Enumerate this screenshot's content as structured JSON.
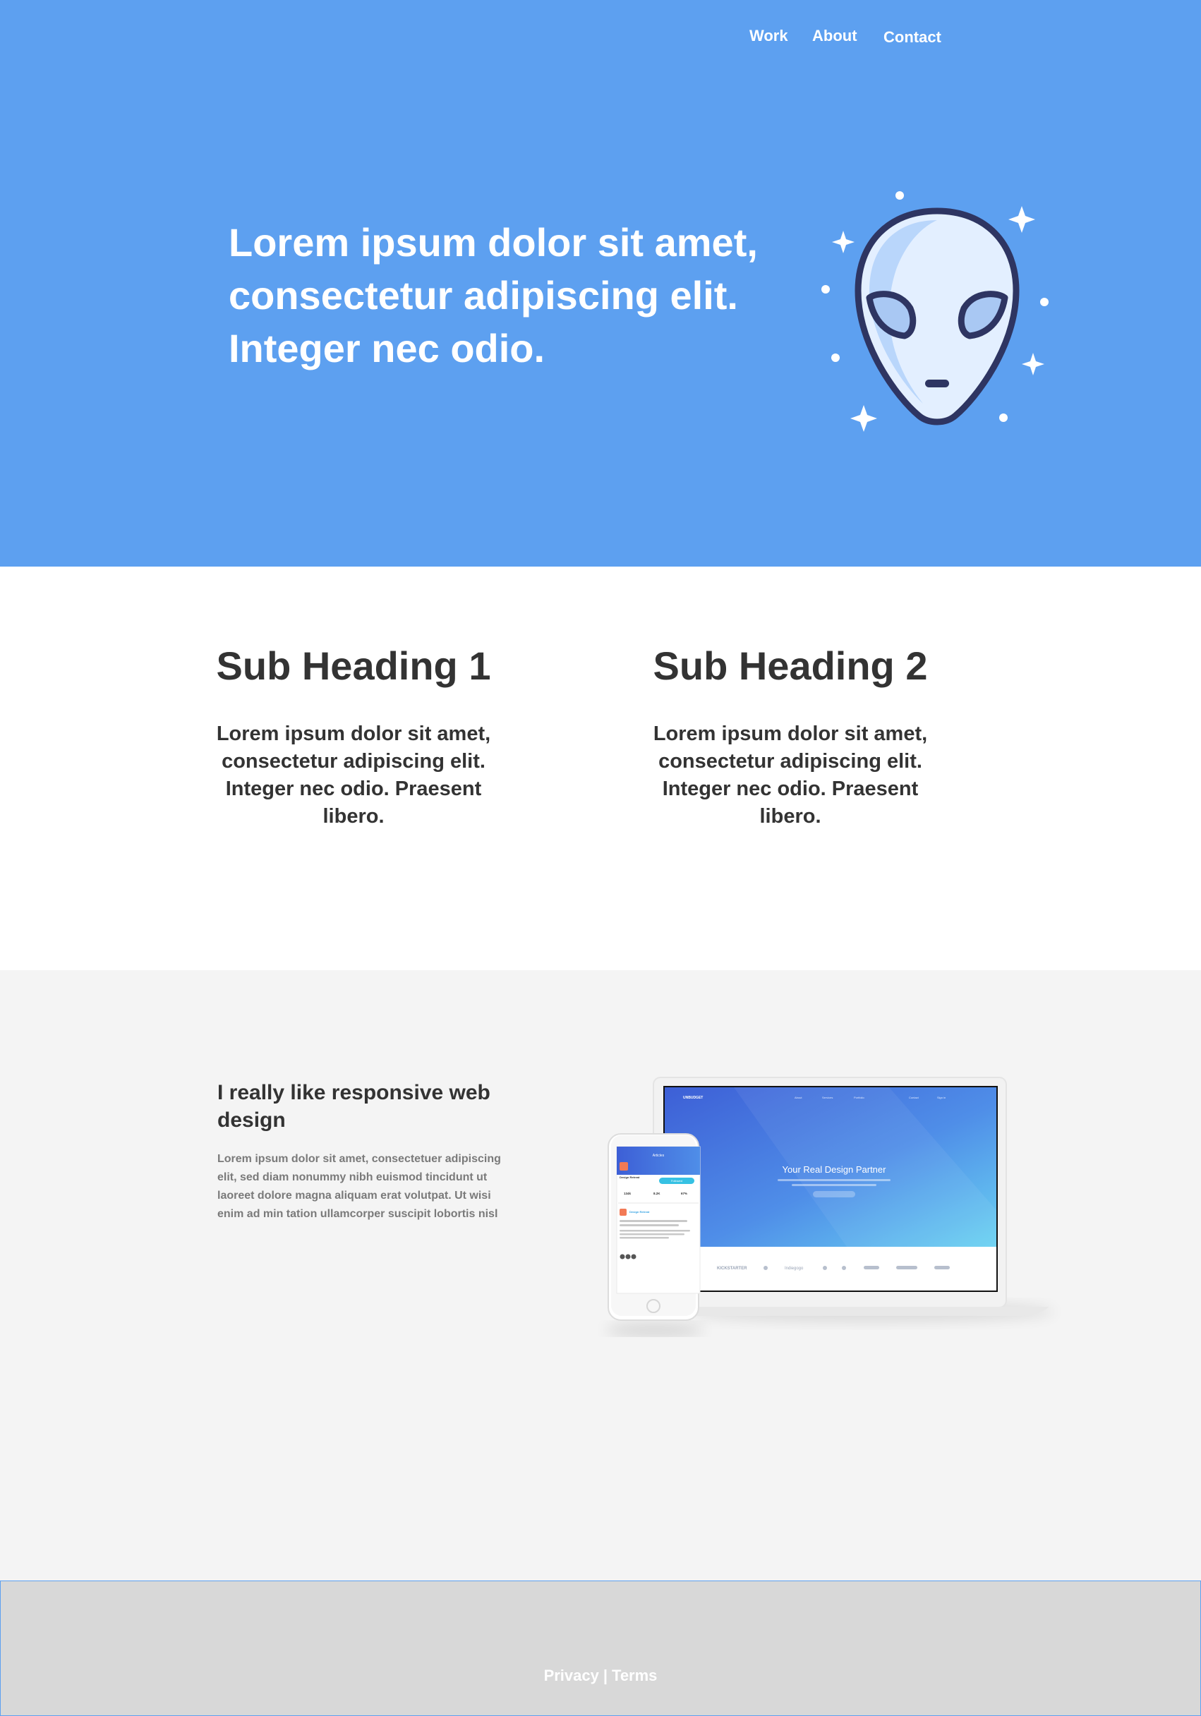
{
  "nav": {
    "work": "Work",
    "about": "About",
    "contact": "Contact"
  },
  "hero": {
    "title": "Lorem ipsum dolor sit amet, consectetur adipiscing elit. Integer nec odio.",
    "illustration_icon": "alien-icon"
  },
  "features": [
    {
      "heading": "Sub Heading 1",
      "text": "Lorem ipsum dolor sit amet, consectetur adipiscing elit. Integer nec odio. Praesent libero."
    },
    {
      "heading": "Sub Heading 2",
      "text": "Lorem ipsum dolor sit amet, consectetur adipiscing elit. Integer nec odio. Praesent libero."
    }
  ],
  "responsive": {
    "heading": "I really like responsive web design",
    "text": "Lorem ipsum dolor sit amet, consectetuer adipiscing elit, sed diam nonummy nibh euismod tincidunt ut laoreet dolore magna aliquam erat volutpat. Ut wisi enim ad min tation ullamcorper suscipit lobortis nisl",
    "laptop_screen": {
      "brand": "UNBUDGET",
      "menu": [
        "About",
        "Services",
        "Portfolio",
        "Contact",
        "Sign in"
      ],
      "headline": "Your Real Design Partner",
      "logos": [
        "KICKSTARTER",
        "Indiegogo"
      ]
    },
    "phone_screen": {
      "title": "Articles",
      "profile_name": "Design Retreat",
      "follow_button": "Followed",
      "stats": [
        "134k",
        "8.2K",
        "67%"
      ],
      "post_author": "Design Retreat"
    }
  },
  "footer": {
    "privacy": "Privacy",
    "separator": "|",
    "terms": "Terms"
  },
  "colors": {
    "hero_bg": "#5da0f0",
    "text_dark": "#333333",
    "section_gray": "#f4f4f4",
    "footer_gray": "#d8d8d8",
    "alien_outline": "#2e3562"
  }
}
